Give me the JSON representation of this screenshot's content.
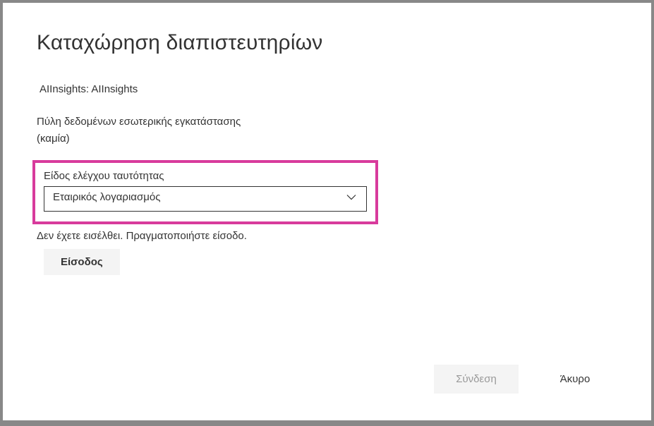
{
  "dialog": {
    "title": "Καταχώρηση διαπιστευτηρίων"
  },
  "info": {
    "dataset_label": "AIInsights: AIInsights"
  },
  "gateway": {
    "label": "Πύλη δεδομένων εσωτερικής εγκατάστασης",
    "value": "(καμία)"
  },
  "auth": {
    "label": "Είδος ελέγχου ταυτότητας",
    "selected": "Εταιρικός λογαριασμός"
  },
  "signin": {
    "status": "Δεν έχετε εισέλθει. Πραγματοποιήστε είσοδο.",
    "button": "Είσοδος"
  },
  "footer": {
    "connect": "Σύνδεση",
    "cancel": "Άκυρο"
  },
  "colors": {
    "highlight": "#d83b9c"
  }
}
